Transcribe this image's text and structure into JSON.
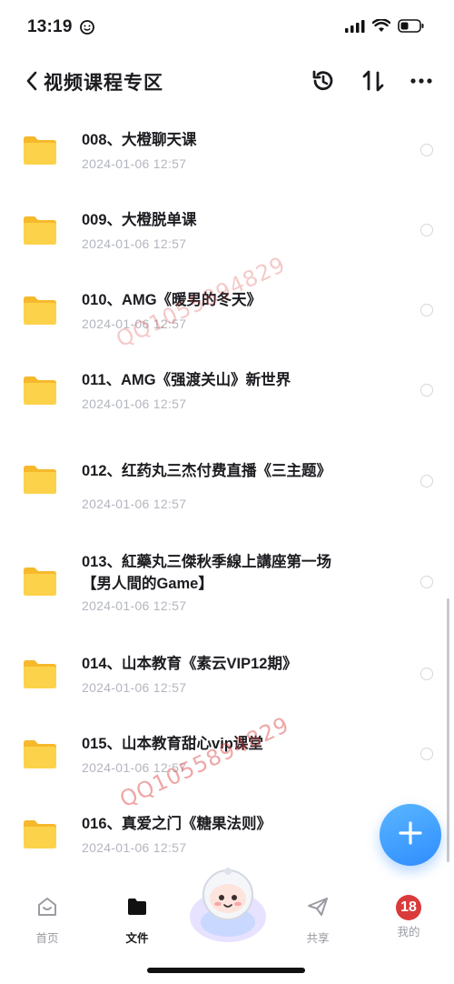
{
  "status_bar": {
    "time": "13:19"
  },
  "navbar": {
    "back_icon": "chevron-left-icon",
    "title": "视频课程专区",
    "icons": [
      "history-icon",
      "sort-icon",
      "more-icon"
    ]
  },
  "items": [
    {
      "name": "008、大橙聊天课",
      "date": "2024-01-06 12:57"
    },
    {
      "name": "009、大橙脱单课",
      "date": "2024-01-06 12:57"
    },
    {
      "name": "010、AMG《暖男的冬天》",
      "date": "2024-01-06 12:57"
    },
    {
      "name": "011、AMG《强渡关山》新世界",
      "date": "2024-01-06 12:57"
    },
    {
      "name": "012、红药丸三杰付费直播《三主题》",
      "date": "2024-01-06 12:57"
    },
    {
      "name": "013、紅藥丸三傑秋季線上講座第一场",
      "name2": "【男人間的Game】",
      "date": "2024-01-06 12:57"
    },
    {
      "name": "014、山本教育《素云VIP12期》",
      "date": "2024-01-06 12:57"
    },
    {
      "name": "015、山本教育甜心vip课堂",
      "date": "2024-01-06 12:57"
    },
    {
      "name": "016、真爱之门《糖果法则》",
      "date": "2024-01-06 12:57"
    }
  ],
  "watermarks": [
    "QQ1055894829",
    "QQ1055894829"
  ],
  "tabbar": {
    "home": "首页",
    "files": "文件",
    "share": "共享",
    "mine": "我的",
    "avatar_text": "18"
  },
  "colors": {
    "accent": "#2f8dff",
    "folder": "#fdd24b",
    "date": "#b4b6bf"
  }
}
